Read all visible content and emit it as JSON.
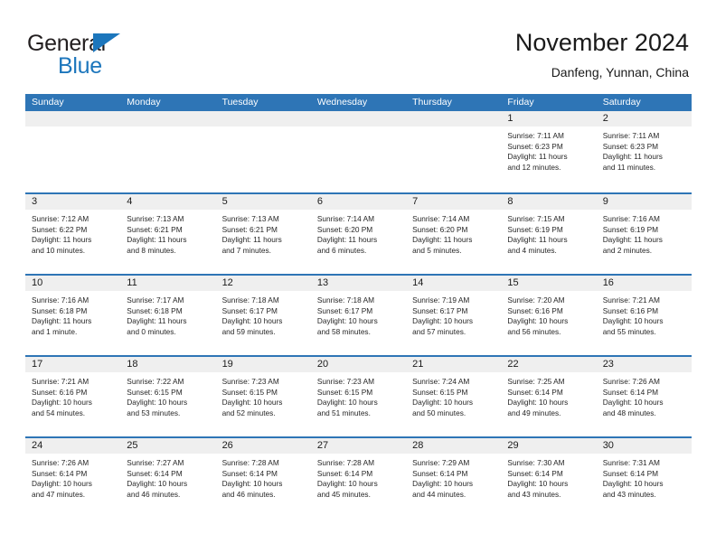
{
  "brand": {
    "name_top": "General",
    "name_bottom": "Blue",
    "triangle_color": "#1c76bc",
    "text_color": "#231f20"
  },
  "header": {
    "title": "November 2024",
    "subtitle": "Danfeng, Yunnan, China"
  },
  "theme": {
    "header_blue": "#2e75b6",
    "day_band_gray": "#efefef",
    "text_color": "#1a1a1a"
  },
  "weekdays": [
    "Sunday",
    "Monday",
    "Tuesday",
    "Wednesday",
    "Thursday",
    "Friday",
    "Saturday"
  ],
  "weeks": [
    [
      {
        "day": "",
        "empty": true,
        "line1": "",
        "line2": "",
        "line3": "",
        "line4": ""
      },
      {
        "day": "",
        "empty": true,
        "line1": "",
        "line2": "",
        "line3": "",
        "line4": ""
      },
      {
        "day": "",
        "empty": true,
        "line1": "",
        "line2": "",
        "line3": "",
        "line4": ""
      },
      {
        "day": "",
        "empty": true,
        "line1": "",
        "line2": "",
        "line3": "",
        "line4": ""
      },
      {
        "day": "",
        "empty": true,
        "line1": "",
        "line2": "",
        "line3": "",
        "line4": ""
      },
      {
        "day": "1",
        "empty": false,
        "line1": "Sunrise: 7:11 AM",
        "line2": "Sunset: 6:23 PM",
        "line3": "Daylight: 11 hours",
        "line4": "and 12 minutes."
      },
      {
        "day": "2",
        "empty": false,
        "line1": "Sunrise: 7:11 AM",
        "line2": "Sunset: 6:23 PM",
        "line3": "Daylight: 11 hours",
        "line4": "and 11 minutes."
      }
    ],
    [
      {
        "day": "3",
        "empty": false,
        "line1": "Sunrise: 7:12 AM",
        "line2": "Sunset: 6:22 PM",
        "line3": "Daylight: 11 hours",
        "line4": "and 10 minutes."
      },
      {
        "day": "4",
        "empty": false,
        "line1": "Sunrise: 7:13 AM",
        "line2": "Sunset: 6:21 PM",
        "line3": "Daylight: 11 hours",
        "line4": "and 8 minutes."
      },
      {
        "day": "5",
        "empty": false,
        "line1": "Sunrise: 7:13 AM",
        "line2": "Sunset: 6:21 PM",
        "line3": "Daylight: 11 hours",
        "line4": "and 7 minutes."
      },
      {
        "day": "6",
        "empty": false,
        "line1": "Sunrise: 7:14 AM",
        "line2": "Sunset: 6:20 PM",
        "line3": "Daylight: 11 hours",
        "line4": "and 6 minutes."
      },
      {
        "day": "7",
        "empty": false,
        "line1": "Sunrise: 7:14 AM",
        "line2": "Sunset: 6:20 PM",
        "line3": "Daylight: 11 hours",
        "line4": "and 5 minutes."
      },
      {
        "day": "8",
        "empty": false,
        "line1": "Sunrise: 7:15 AM",
        "line2": "Sunset: 6:19 PM",
        "line3": "Daylight: 11 hours",
        "line4": "and 4 minutes."
      },
      {
        "day": "9",
        "empty": false,
        "line1": "Sunrise: 7:16 AM",
        "line2": "Sunset: 6:19 PM",
        "line3": "Daylight: 11 hours",
        "line4": "and 2 minutes."
      }
    ],
    [
      {
        "day": "10",
        "empty": false,
        "line1": "Sunrise: 7:16 AM",
        "line2": "Sunset: 6:18 PM",
        "line3": "Daylight: 11 hours",
        "line4": "and 1 minute."
      },
      {
        "day": "11",
        "empty": false,
        "line1": "Sunrise: 7:17 AM",
        "line2": "Sunset: 6:18 PM",
        "line3": "Daylight: 11 hours",
        "line4": "and 0 minutes."
      },
      {
        "day": "12",
        "empty": false,
        "line1": "Sunrise: 7:18 AM",
        "line2": "Sunset: 6:17 PM",
        "line3": "Daylight: 10 hours",
        "line4": "and 59 minutes."
      },
      {
        "day": "13",
        "empty": false,
        "line1": "Sunrise: 7:18 AM",
        "line2": "Sunset: 6:17 PM",
        "line3": "Daylight: 10 hours",
        "line4": "and 58 minutes."
      },
      {
        "day": "14",
        "empty": false,
        "line1": "Sunrise: 7:19 AM",
        "line2": "Sunset: 6:17 PM",
        "line3": "Daylight: 10 hours",
        "line4": "and 57 minutes."
      },
      {
        "day": "15",
        "empty": false,
        "line1": "Sunrise: 7:20 AM",
        "line2": "Sunset: 6:16 PM",
        "line3": "Daylight: 10 hours",
        "line4": "and 56 minutes."
      },
      {
        "day": "16",
        "empty": false,
        "line1": "Sunrise: 7:21 AM",
        "line2": "Sunset: 6:16 PM",
        "line3": "Daylight: 10 hours",
        "line4": "and 55 minutes."
      }
    ],
    [
      {
        "day": "17",
        "empty": false,
        "line1": "Sunrise: 7:21 AM",
        "line2": "Sunset: 6:16 PM",
        "line3": "Daylight: 10 hours",
        "line4": "and 54 minutes."
      },
      {
        "day": "18",
        "empty": false,
        "line1": "Sunrise: 7:22 AM",
        "line2": "Sunset: 6:15 PM",
        "line3": "Daylight: 10 hours",
        "line4": "and 53 minutes."
      },
      {
        "day": "19",
        "empty": false,
        "line1": "Sunrise: 7:23 AM",
        "line2": "Sunset: 6:15 PM",
        "line3": "Daylight: 10 hours",
        "line4": "and 52 minutes."
      },
      {
        "day": "20",
        "empty": false,
        "line1": "Sunrise: 7:23 AM",
        "line2": "Sunset: 6:15 PM",
        "line3": "Daylight: 10 hours",
        "line4": "and 51 minutes."
      },
      {
        "day": "21",
        "empty": false,
        "line1": "Sunrise: 7:24 AM",
        "line2": "Sunset: 6:15 PM",
        "line3": "Daylight: 10 hours",
        "line4": "and 50 minutes."
      },
      {
        "day": "22",
        "empty": false,
        "line1": "Sunrise: 7:25 AM",
        "line2": "Sunset: 6:14 PM",
        "line3": "Daylight: 10 hours",
        "line4": "and 49 minutes."
      },
      {
        "day": "23",
        "empty": false,
        "line1": "Sunrise: 7:26 AM",
        "line2": "Sunset: 6:14 PM",
        "line3": "Daylight: 10 hours",
        "line4": "and 48 minutes."
      }
    ],
    [
      {
        "day": "24",
        "empty": false,
        "line1": "Sunrise: 7:26 AM",
        "line2": "Sunset: 6:14 PM",
        "line3": "Daylight: 10 hours",
        "line4": "and 47 minutes."
      },
      {
        "day": "25",
        "empty": false,
        "line1": "Sunrise: 7:27 AM",
        "line2": "Sunset: 6:14 PM",
        "line3": "Daylight: 10 hours",
        "line4": "and 46 minutes."
      },
      {
        "day": "26",
        "empty": false,
        "line1": "Sunrise: 7:28 AM",
        "line2": "Sunset: 6:14 PM",
        "line3": "Daylight: 10 hours",
        "line4": "and 46 minutes."
      },
      {
        "day": "27",
        "empty": false,
        "line1": "Sunrise: 7:28 AM",
        "line2": "Sunset: 6:14 PM",
        "line3": "Daylight: 10 hours",
        "line4": "and 45 minutes."
      },
      {
        "day": "28",
        "empty": false,
        "line1": "Sunrise: 7:29 AM",
        "line2": "Sunset: 6:14 PM",
        "line3": "Daylight: 10 hours",
        "line4": "and 44 minutes."
      },
      {
        "day": "29",
        "empty": false,
        "line1": "Sunrise: 7:30 AM",
        "line2": "Sunset: 6:14 PM",
        "line3": "Daylight: 10 hours",
        "line4": "and 43 minutes."
      },
      {
        "day": "30",
        "empty": false,
        "line1": "Sunrise: 7:31 AM",
        "line2": "Sunset: 6:14 PM",
        "line3": "Daylight: 10 hours",
        "line4": "and 43 minutes."
      }
    ]
  ]
}
